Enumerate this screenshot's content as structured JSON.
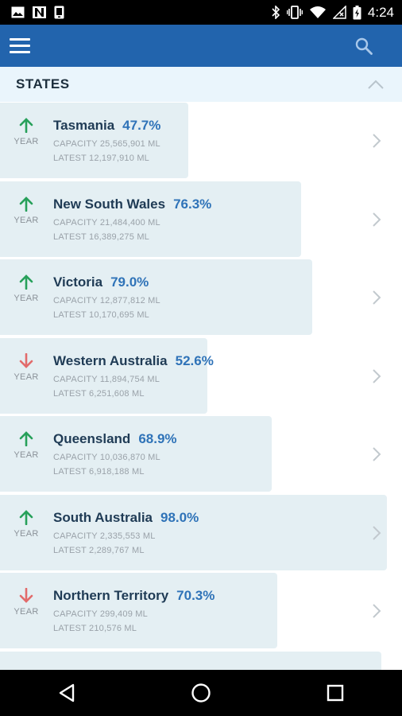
{
  "status_bar": {
    "time": "4:24",
    "left_icons": [
      "image-icon",
      "n-icon",
      "phone-icon"
    ],
    "right_icons": [
      "bluetooth-icon",
      "vibrate-icon",
      "wifi-icon",
      "signal-icon",
      "battery-icon"
    ]
  },
  "app_bar": {
    "menu_icon": "hamburger-menu-icon",
    "search_icon": "search-icon",
    "color": "#2264ad"
  },
  "section": {
    "title": "STATES"
  },
  "colors": {
    "up": "#27a05a",
    "down": "#e26b6b",
    "bar": "#e4eff3",
    "percent": "#2f73b8"
  },
  "states": [
    {
      "name": "Tasmania",
      "percent": "47.7%",
      "fill": 0.477,
      "trend": "up",
      "trend_label": "YEAR",
      "capacity": "CAPACITY 25,565,901 ML",
      "latest": "LATEST 12,197,910 ML"
    },
    {
      "name": "New South Wales",
      "percent": "76.3%",
      "fill": 0.763,
      "trend": "up",
      "trend_label": "YEAR",
      "capacity": "CAPACITY 21,484,400 ML",
      "latest": "LATEST 16,389,275 ML"
    },
    {
      "name": "Victoria",
      "percent": "79.0%",
      "fill": 0.79,
      "trend": "up",
      "trend_label": "YEAR",
      "capacity": "CAPACITY 12,877,812 ML",
      "latest": "LATEST 10,170,695 ML"
    },
    {
      "name": "Western Australia",
      "percent": "52.6%",
      "fill": 0.526,
      "trend": "down",
      "trend_label": "YEAR",
      "capacity": "CAPACITY 11,894,754 ML",
      "latest": "LATEST 6,251,608 ML"
    },
    {
      "name": "Queensland",
      "percent": "68.9%",
      "fill": 0.689,
      "trend": "up",
      "trend_label": "YEAR",
      "capacity": "CAPACITY 10,036,870 ML",
      "latest": "LATEST 6,918,188 ML"
    },
    {
      "name": "South Australia",
      "percent": "98.0%",
      "fill": 0.98,
      "trend": "up",
      "trend_label": "YEAR",
      "capacity": "CAPACITY 2,335,553 ML",
      "latest": "LATEST 2,289,767 ML"
    },
    {
      "name": "Northern Territory",
      "percent": "70.3%",
      "fill": 0.703,
      "trend": "down",
      "trend_label": "YEAR",
      "capacity": "CAPACITY 299,409 ML",
      "latest": "LATEST 210,576 ML"
    },
    {
      "name": "",
      "percent": "",
      "fill": 0.965,
      "trend": "",
      "trend_label": "",
      "capacity": "",
      "latest": ""
    }
  ],
  "nav_bar": {
    "back_icon": "back-icon",
    "home_icon": "home-icon",
    "recents_icon": "recents-icon"
  }
}
